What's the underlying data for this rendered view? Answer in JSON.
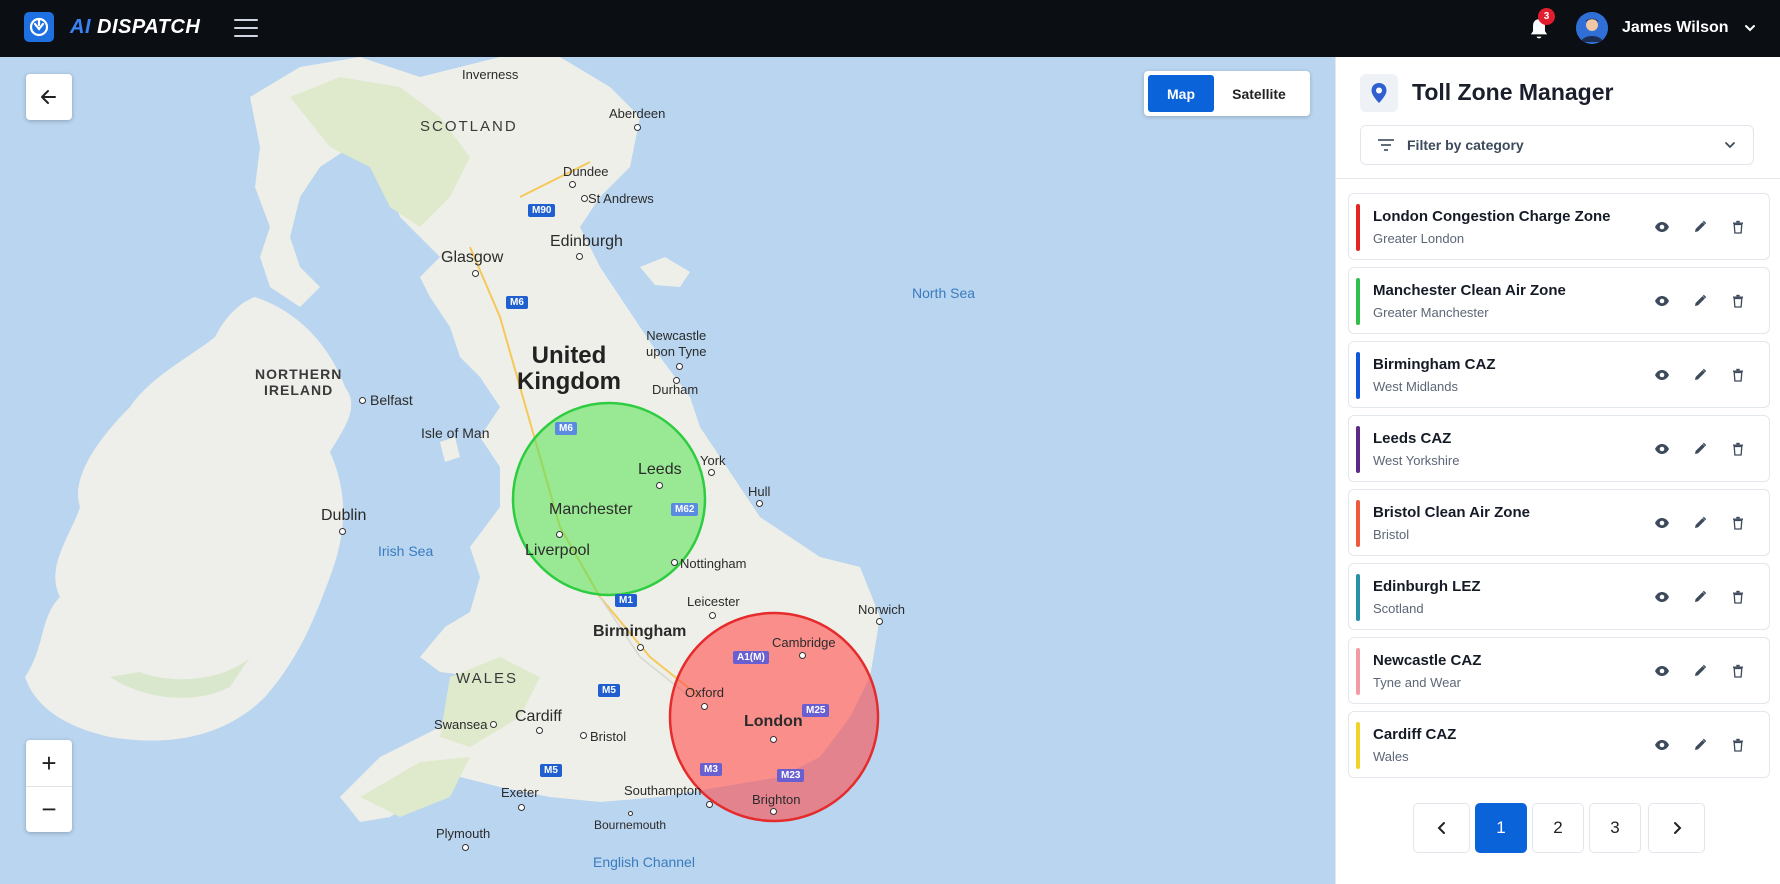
{
  "brand": {
    "name": "AI DISPATCH",
    "prefix": "AI",
    "suffix": " DISPATCH"
  },
  "header": {
    "notification_count": "3",
    "user_name": "James Wilson"
  },
  "map": {
    "map_type": {
      "map_label": "Map",
      "satellite_label": "Satellite",
      "selected": "Map"
    },
    "labels": {
      "inverness": "Inverness",
      "scotland": "SCOTLAND",
      "aberdeen": "Aberdeen",
      "dundee": "Dundee",
      "st_andrews": "St Andrews",
      "edinburgh": "Edinburgh",
      "glasgow": "Glasgow",
      "northern_ireland_1": "NORTHERN",
      "northern_ireland_2": "IRELAND",
      "belfast": "Belfast",
      "uk_1": "United",
      "uk_2": "Kingdom",
      "newcastle_1": "Newcastle",
      "newcastle_2": "upon Tyne",
      "durham": "Durham",
      "isle_of_man": "Isle of Man",
      "york": "York",
      "leeds": "Leeds",
      "hull": "Hull",
      "manchester": "Manchester",
      "liverpool": "Liverpool",
      "dublin": "Dublin",
      "irish_sea": "Irish Sea",
      "north_sea": "North Sea",
      "nottingham": "Nottingham",
      "leicester": "Leicester",
      "norwich": "Norwich",
      "birmingham": "Birmingham",
      "cambridge": "Cambridge",
      "wales": "WALES",
      "oxford": "Oxford",
      "london": "London",
      "swansea": "Swansea",
      "cardiff": "Cardiff",
      "bristol": "Bristol",
      "exeter": "Exeter",
      "southampton": "Southampton",
      "bournemouth": "Bournemouth",
      "brighton": "Brighton",
      "plymouth": "Plymouth",
      "english_channel": "English Channel"
    },
    "roads": {
      "m90": "M90",
      "m6_north": "M6",
      "m6_south": "M6",
      "m62": "M62",
      "m1": "M1",
      "a1m": "A1(M)",
      "m5_north": "M5",
      "m5_south": "M5",
      "m25": "M25",
      "m3": "M3",
      "m23": "M23"
    },
    "zone_circles": [
      {
        "zone": "Manchester Clean Air Zone",
        "color": "#2ecc40"
      },
      {
        "zone": "London Congestion Charge Zone",
        "color": "#e52b2b"
      }
    ]
  },
  "panel": {
    "title": "Toll Zone Manager",
    "filter_label": "Filter by category",
    "zones": [
      {
        "name": "London Congestion Charge Zone",
        "region": "Greater London",
        "color": "#e52424"
      },
      {
        "name": "Manchester Clean Air Zone",
        "region": "Greater Manchester",
        "color": "#2fbf4a"
      },
      {
        "name": "Birmingham CAZ",
        "region": "West Midlands",
        "color": "#1155d8"
      },
      {
        "name": "Leeds CAZ",
        "region": "West Yorkshire",
        "color": "#5b2a86"
      },
      {
        "name": "Bristol Clean Air Zone",
        "region": "Bristol",
        "color": "#ef5a3c"
      },
      {
        "name": "Edinburgh LEZ",
        "region": "Scotland",
        "color": "#2a8fa8"
      },
      {
        "name": "Newcastle CAZ",
        "region": "Tyne and Wear",
        "color": "#f29aa5"
      },
      {
        "name": "Cardiff CAZ",
        "region": "Wales",
        "color": "#f0d42a"
      }
    ],
    "pagination": {
      "pages": [
        "1",
        "2",
        "3"
      ],
      "current": "1"
    }
  },
  "icons": {
    "logo": "logo-icon",
    "menu": "hamburger-icon",
    "bell": "bell-icon",
    "chevron": "chevron-down-icon",
    "back": "arrow-left-icon",
    "pin": "map-pin-icon",
    "filter": "filter-icon",
    "view": "eye-icon",
    "edit": "pencil-icon",
    "delete": "trash-icon"
  }
}
